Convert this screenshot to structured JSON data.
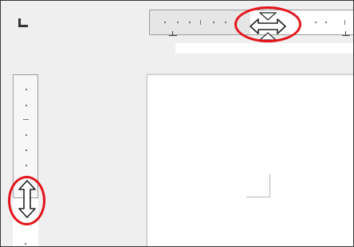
{
  "window": {
    "description_text": ""
  },
  "rulers": {
    "horizontal_icon": "horizontal-ruler-icon",
    "vertical_icon": "vertical-ruler-icon"
  },
  "tab_selector": {
    "icon": "left-tab-selector-icon"
  },
  "cursors": {
    "horizontal": "horizontal-resize-cursor-icon",
    "vertical": "vertical-resize-cursor-icon"
  },
  "colors": {
    "highlight": "#e3141c",
    "canvas": "#efefef",
    "page": "#ffffff",
    "ruler": "#f7f7f7"
  }
}
